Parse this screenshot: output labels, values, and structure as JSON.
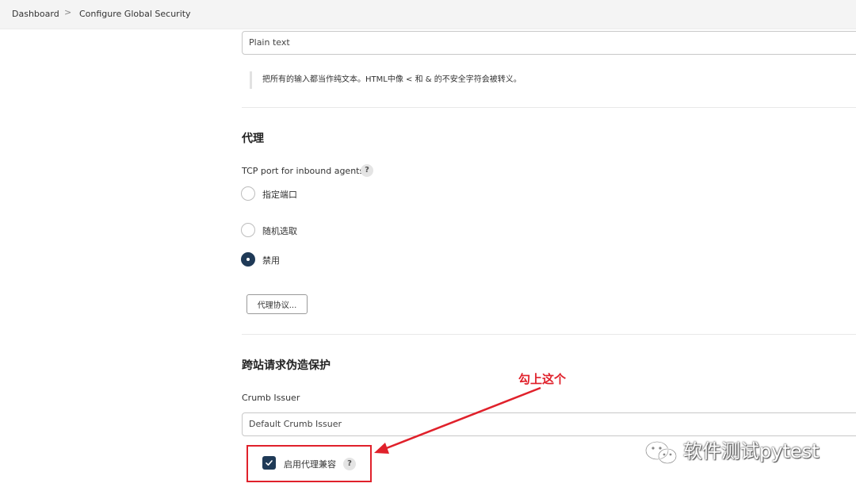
{
  "breadcrumb": {
    "items": [
      "Dashboard",
      "Configure Global Security"
    ],
    "separator": ">"
  },
  "markup": {
    "formatter_value": "Plain text",
    "formatter_help": "把所有的输入都当作纯文本。HTML中像 < 和 & 的不安全字符会被转义。"
  },
  "agents": {
    "title": "代理",
    "tcp_label": "TCP port for inbound agents",
    "help": "?",
    "options": [
      {
        "label": "指定端口",
        "checked": false
      },
      {
        "label": "随机选取",
        "checked": false
      },
      {
        "label": "禁用",
        "checked": true
      }
    ],
    "protocols_button": "代理协议..."
  },
  "csrf": {
    "title": "跨站请求伪造保护",
    "crumb_label": "Crumb Issuer",
    "crumb_value": "Default Crumb Issuer",
    "proxy_compat_label": "启用代理兼容",
    "proxy_compat_checked": true,
    "help": "?"
  },
  "annotation": {
    "text": "勾上这个",
    "color": "#e0212b"
  },
  "watermark": {
    "text": "软件测试pytest",
    "icon": "wechat-icon"
  },
  "colors": {
    "accent": "#1f3a57",
    "topbar": "#f4f4f4"
  }
}
